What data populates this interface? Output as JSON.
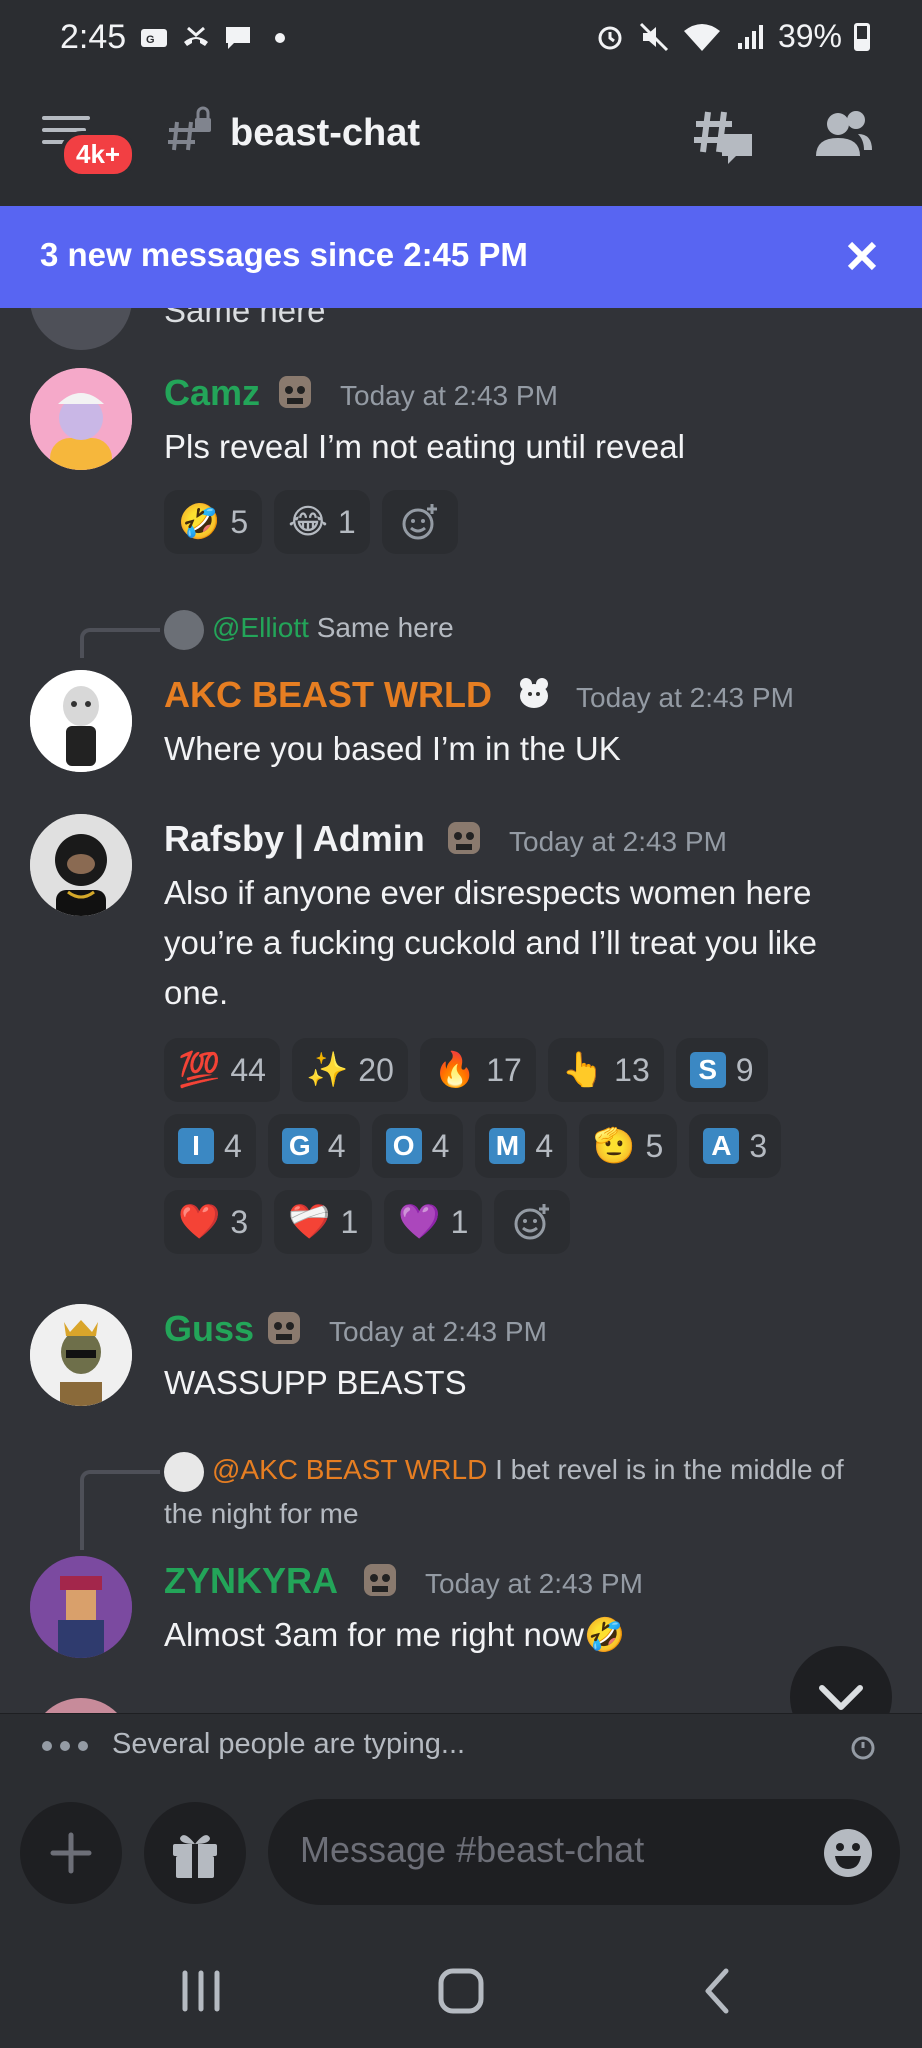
{
  "status_bar": {
    "time": "2:45",
    "battery": "39%"
  },
  "header": {
    "badge": "4k+",
    "channel": "beast-chat"
  },
  "new_messages_bar": {
    "text": "3 new messages since 2:45 PM"
  },
  "partial_text": "Same here",
  "messages": [
    {
      "username": "Camz",
      "name_color": "#23a559",
      "timestamp": "Today at 2:43 PM",
      "text": "Pls reveal I’m not eating until reveal",
      "reactions": [
        {
          "emoji": "🤣",
          "count": "5"
        },
        {
          "emoji": "😂",
          "count": "1"
        }
      ]
    },
    {
      "reply": {
        "mention": "@Elliott",
        "text": "Same here"
      },
      "username": "AKC BEAST WRLD",
      "name_color": "#e67e22",
      "timestamp": "Today at 2:43 PM",
      "text": "Where you based I’m in the UK"
    },
    {
      "username": "Rafsby | Admin",
      "name_color": "#f2f3f5",
      "timestamp": "Today at 2:43 PM",
      "text_lines": [
        "Also if anyone ever disrespects women here",
        "you’re a fucking cuckold and I’ll treat you like",
        "one."
      ],
      "reactions": [
        {
          "emoji": "💯",
          "count": "44"
        },
        {
          "emoji": "✨",
          "count": "20"
        },
        {
          "emoji": "🔥",
          "count": "17"
        },
        {
          "emoji": "👆",
          "count": "13"
        },
        {
          "letter": "S",
          "count": "9"
        },
        {
          "letter": "I",
          "count": "4"
        },
        {
          "letter": "G",
          "count": "4"
        },
        {
          "letter": "O",
          "count": "4"
        },
        {
          "letter": "M",
          "count": "4"
        },
        {
          "emoji": "🫡",
          "count": "5"
        },
        {
          "letter": "A",
          "count": "3"
        },
        {
          "emoji": "❤️",
          "count": "3"
        },
        {
          "emoji": "❤️‍🩹",
          "count": "1"
        },
        {
          "emoji": "💜",
          "count": "1"
        }
      ]
    },
    {
      "username": "Guss",
      "name_color": "#23a559",
      "timestamp": "Today at 2:43 PM",
      "text": "WASSUPP BEASTS"
    },
    {
      "reply": {
        "mention": "@AKC BEAST WRLD",
        "text_line1": "I bet revel is in the middle of",
        "text_line2": "the night for me"
      },
      "username": "ZYNKYRA",
      "name_color": "#23a559",
      "timestamp": "Today at 2:43 PM",
      "text": "Almost 3am for me right now🤣"
    }
  ],
  "typing": {
    "text": "Several people are typing..."
  },
  "composer": {
    "placeholder": "Message #beast-chat"
  },
  "colors": {
    "blurple": "#5865f2",
    "green": "#23a559",
    "orange": "#e67e22",
    "red": "#f23f43"
  }
}
